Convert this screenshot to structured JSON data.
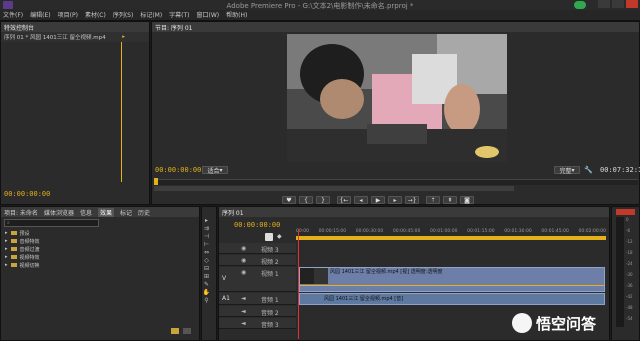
{
  "window": {
    "title": "Adobe Premiere Pro - G:\\文本2\\电影制作\\未命名.prproj *"
  },
  "menu": [
    "文件(F)",
    "编辑(E)",
    "项目(P)",
    "素材(C)",
    "序列(S)",
    "标记(M)",
    "字幕(T)",
    "窗口(W)",
    "帮助(H)"
  ],
  "effect_controls": {
    "tabs": [
      "特效控制台"
    ],
    "clip_label": "序列 01 * 风园 1401三江 留仝视频.mp4",
    "timecode": "00:00:00:00"
  },
  "program_monitor": {
    "tab": "节目: 序列 01",
    "timecode_left": "00:00:00:00",
    "fit_label": "适合",
    "quality_label": "完整",
    "timecode_right": "00:07:32:17"
  },
  "project_panel": {
    "tabs": [
      "项目: 未命名",
      "媒体浏览器",
      "信息",
      "效果",
      "标记",
      "历史"
    ],
    "active_tab": "效果",
    "folders": [
      "预设",
      "音频特效",
      "音频过渡",
      "视频特效",
      "视频切换"
    ]
  },
  "timeline": {
    "tab": "序列 01",
    "timecode": "00:00:00:00",
    "ruler": [
      "00:00",
      "00:00:15:00",
      "00:00:30:00",
      "00:00:45:00",
      "00:01:00:00",
      "00:01:15:00",
      "00:01:30:00",
      "00:01:45:00",
      "00:02:00:00"
    ],
    "video_tracks": [
      "视频 3",
      "视频 2",
      "视频 1"
    ],
    "audio_tracks": [
      "音频 1",
      "音频 2",
      "音频 3"
    ],
    "target_v": "V",
    "target_a": "A1",
    "video_clip_label": "风园 1401三江 留仝视频.mp4 [视] 透明度:透明度",
    "audio_clip_label": "风园 1401三江 留仝视频.mp4 [音]"
  },
  "meter_scale": [
    "0",
    "-6",
    "-12",
    "-18",
    "-24",
    "-30",
    "-36",
    "-42",
    "-48",
    "-54"
  ],
  "watermark": {
    "text": "悟空问答"
  }
}
